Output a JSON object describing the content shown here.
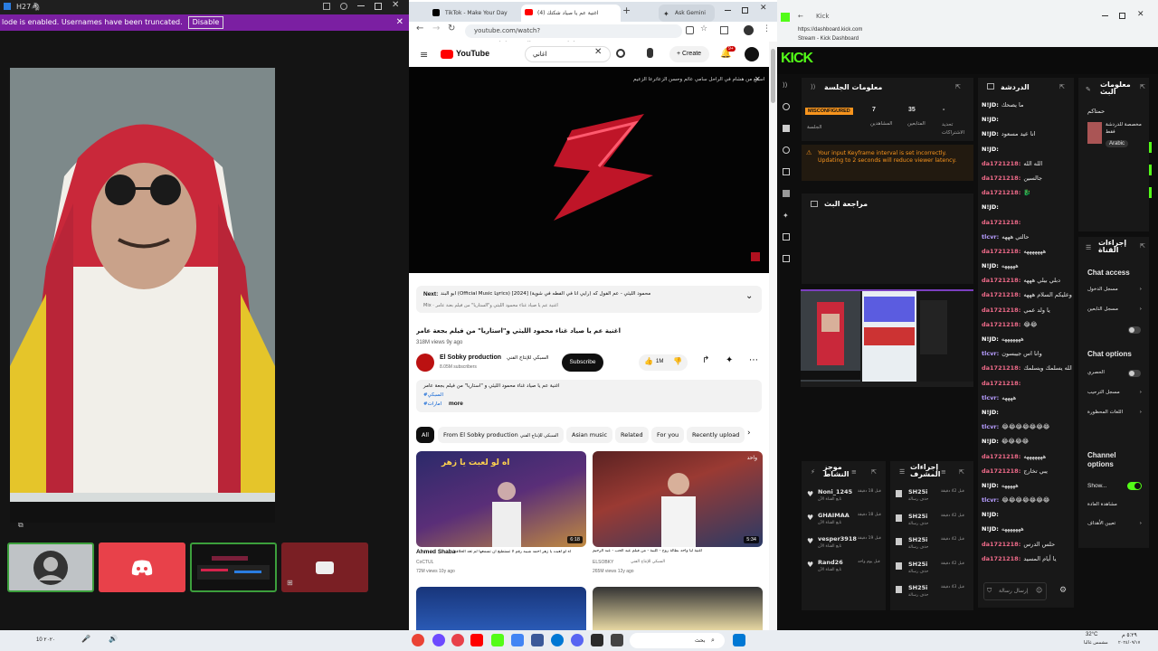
{
  "left_window": {
    "title": "H27🦓",
    "banner_text": "lode is enabled. Usernames have been truncated.",
    "banner_button": "Disable"
  },
  "browser": {
    "tabs": [
      {
        "label": "TikTok - Make Your Day"
      },
      {
        "label": "اغنية عم يا صياد شكتك (4)"
      },
      {
        "label": "Ask Gemini"
      }
    ],
    "url": "youtube.com/watch?v=8S47lghsJBo&list=RD8S47lghsJBo&start_ra...",
    "search_value": "اغاني",
    "create_label": "Create",
    "notif_count": "9+",
    "video_banner": "اسمع من هشام في الراحل سامي عائم وحسن الزعاترعا الزعيم",
    "next_label": "Next:",
    "next_text": "ابو البند (Official Music Lyrics) [2024] محمود الليثي - عم الفول كه (رايي أنا في الفطه في شوية)",
    "next_sub": "Mix · اغنية عم يا صياد غناء محمود الليثي و\"الستاريا\" من فيلم بعنة عامر",
    "video_title": "اغنية عم يا صياد غناء محمود الليثي و\"استاريا\" من فيلم بجعة عامر",
    "views": "318M views  9y ago",
    "channel": "El Sobky production",
    "channel_ar": "السبكي للإنتاج الفني",
    "subs": "8.05M subscribers",
    "subscribe": "Subscribe",
    "likes": "1M",
    "desc_line1": "اغنية عم يا صياد غناء محمود الليثي و \"استاريا\" من فيلم بجعة عامر",
    "desc_tag1": "#السبكي",
    "desc_tag2": "#امارات",
    "more": "more",
    "chips": [
      "All",
      "From El Sobky production",
      "Asian music",
      "Related",
      "For you",
      "Recently upload"
    ],
    "chip_sub": "السبكي للإنتاج الفني",
    "videos": [
      {
        "title": "Ahmed Shaba",
        "title_ar": "اه لو لعبت يا زهر احمد شيبه رقم لا تستطيع ان تسمعها لم تعد الحلاقة",
        "channel": "CoCTUL",
        "meta": "72M views  10y ago",
        "duration": "6:18",
        "thumb_text": "اه لو لعبت يا زهر"
      },
      {
        "title": "اغنية ليا واحد بطالة روح - كليبة - من فيلم عيد الحب - عبد الرحيم",
        "title_ar": "",
        "channel": "ELSOBKY",
        "channel_ar": "السبكي للإنتاج الفني",
        "meta": "265M views  12y ago",
        "duration": "5:34",
        "thumb_text": "واحد"
      }
    ]
  },
  "kick": {
    "window_title": "Kick",
    "url": "https://dashboard.kick.com",
    "page_title": "Stream - Kick Dashboard",
    "logo": "KICK",
    "session_title": "معلومات الجلسة",
    "stat_badge": "MISCONFIGURED",
    "stats": [
      {
        "value": "7",
        "label": "المشاهدين"
      },
      {
        "value": "35",
        "label": "المتابعين"
      },
      {
        "value": "-",
        "label": "تحديد الاشتراكات"
      }
    ],
    "stat_badge_label": "الجلسة",
    "warning": "Your input Keyframe interval is set incorrectly. Updating to 2 seconds will reduce viewer latency.",
    "review_title": "مراجعة البث",
    "chat_title": "الدردشة",
    "chat": [
      {
        "user": "N!JD:",
        "msg": "ما يصحك",
        "cls": "u2"
      },
      {
        "user": "N!JD:",
        "msg": "",
        "cls": "u2"
      },
      {
        "user": "N!JD:",
        "msg": "انا عيد مسعود",
        "cls": "u2"
      },
      {
        "user": "N!JD:",
        "msg": "",
        "cls": "u2"
      },
      {
        "user": "da1721218:",
        "msg": "الله الله",
        "cls": "u1"
      },
      {
        "user": "da1721218:",
        "msg": "جالسين",
        "cls": "u1"
      },
      {
        "user": "da1721218:",
        "msg": "🐉",
        "cls": "u1"
      },
      {
        "user": "N!JD:",
        "msg": "",
        "cls": "u2"
      },
      {
        "user": "da1721218:",
        "msg": "",
        "cls": "u1"
      },
      {
        "user": "tlcvr:",
        "msg": "حالتي هههه",
        "cls": "u3"
      },
      {
        "user": "da1721218:",
        "msg": "هههههههه",
        "cls": "u1"
      },
      {
        "user": "N!JD:",
        "msg": "هههههه",
        "cls": "u2"
      },
      {
        "user": "da1721218:",
        "msg": "دبلي بيلي هههه",
        "cls": "u1"
      },
      {
        "user": "da1721218:",
        "msg": "وعليكم السلام هههه",
        "cls": "u1"
      },
      {
        "user": "da1721218:",
        "msg": "يا ولد عمي",
        "cls": "u1"
      },
      {
        "user": "da1721218:",
        "msg": "😂😂",
        "cls": "u1"
      },
      {
        "user": "N!JD:",
        "msg": "هههههههه",
        "cls": "u2"
      },
      {
        "user": "tlcvr:",
        "msg": "وانا اس جيبسون",
        "cls": "u3"
      },
      {
        "user": "da1721218:",
        "msg": "الله يسلمك ويسلمك",
        "cls": "u1"
      },
      {
        "user": "da1721218:",
        "msg": "",
        "cls": "u1"
      },
      {
        "user": "tlcvr:",
        "msg": "ههههه",
        "cls": "u3"
      },
      {
        "user": "N!JD:",
        "msg": "",
        "cls": "u2"
      },
      {
        "user": "tlcvr:",
        "msg": "😂😂😂😂😂😂😂",
        "cls": "u3"
      },
      {
        "user": "N!JD:",
        "msg": "😂😂😂😂",
        "cls": "u2"
      },
      {
        "user": "da1721218:",
        "msg": "هههههههه",
        "cls": "u1"
      },
      {
        "user": "da1721218:",
        "msg": "يبي تخارج",
        "cls": "u1"
      },
      {
        "user": "N!JD:",
        "msg": "هههههه",
        "cls": "u2"
      },
      {
        "user": "tlcvr:",
        "msg": "😂😂😂😂😂😂😂",
        "cls": "u3"
      },
      {
        "user": "N!JD:",
        "msg": "",
        "cls": "u2"
      },
      {
        "user": "N!JD:",
        "msg": "هههههههه",
        "cls": "u2"
      },
      {
        "user": "da1721218:",
        "msg": "حلس الدرس",
        "cls": "u1"
      },
      {
        "user": "da1721218:",
        "msg": "يا أيام المسيد",
        "cls": "u1"
      }
    ],
    "chat_placeholder": "إرسال رسالة",
    "info_title": "معلومات البث",
    "info_label": "حمتاكم",
    "info_sub": "مخصصة للدردشة فقط",
    "info_lang": "Arabic",
    "channel_actions_title": "إجراءات القناة",
    "chat_access": "Chat access",
    "access_rows": [
      "مسجل الدخول",
      "مسجل التابعين"
    ],
    "chat_options": "Chat options",
    "options_rows": [
      "الحصري",
      "مسجل الترحيب",
      "اللغات المحظورة"
    ],
    "channel_options": "Channel options",
    "channel_rows": [
      "Show...",
      "مشاهدة العادة",
      "تعيين الأهداف"
    ],
    "mod_title": "إجراءات المشرف",
    "activity_title": "موجز النشاط",
    "activity": [
      {
        "user": "Noni_1245",
        "sub": "تابع القناة الآن",
        "time": "قبل 18 دقيقة"
      },
      {
        "user": "GHAIMAA",
        "sub": "تابع القناة الآن",
        "time": "قبل 18 دقيقة"
      },
      {
        "user": "vesper3918",
        "sub": "تابع القناة الآن",
        "time": "قبل 19 دقيقة"
      },
      {
        "user": "Rand26",
        "sub": "تابع القناة الآن",
        "time": "قبل يوم واحد"
      }
    ],
    "mod": [
      {
        "user": "SH25i",
        "sub": "حذف رسالة",
        "time": "قبل 42 دقيقة"
      },
      {
        "user": "SH25i",
        "sub": "حذف رسالة",
        "time": "قبل 42 دقيقة"
      },
      {
        "user": "SH25i",
        "sub": "حذف رسالة",
        "time": "قبل 42 دقيقة"
      },
      {
        "user": "SH25i",
        "sub": "حذف رسالة",
        "time": "قبل 42 دقيقة"
      },
      {
        "user": "SH25i",
        "sub": "حذف رسالة",
        "time": "قبل 43 دقيقة"
      }
    ]
  },
  "taskbar": {
    "left_text": "10 ۲۰۲۰",
    "search": "بحث",
    "clock_time": "٥:٢٩ م",
    "clock_date": "٢٠٢٤/٠٩/١٧",
    "weather": "32°C",
    "weather_sub": "مشمس غالبا"
  },
  "colors": {
    "kick_green": "#53fc18",
    "yt_red": "#ff0000",
    "discord": "#e8414a",
    "banner": "#7b1fa2"
  }
}
